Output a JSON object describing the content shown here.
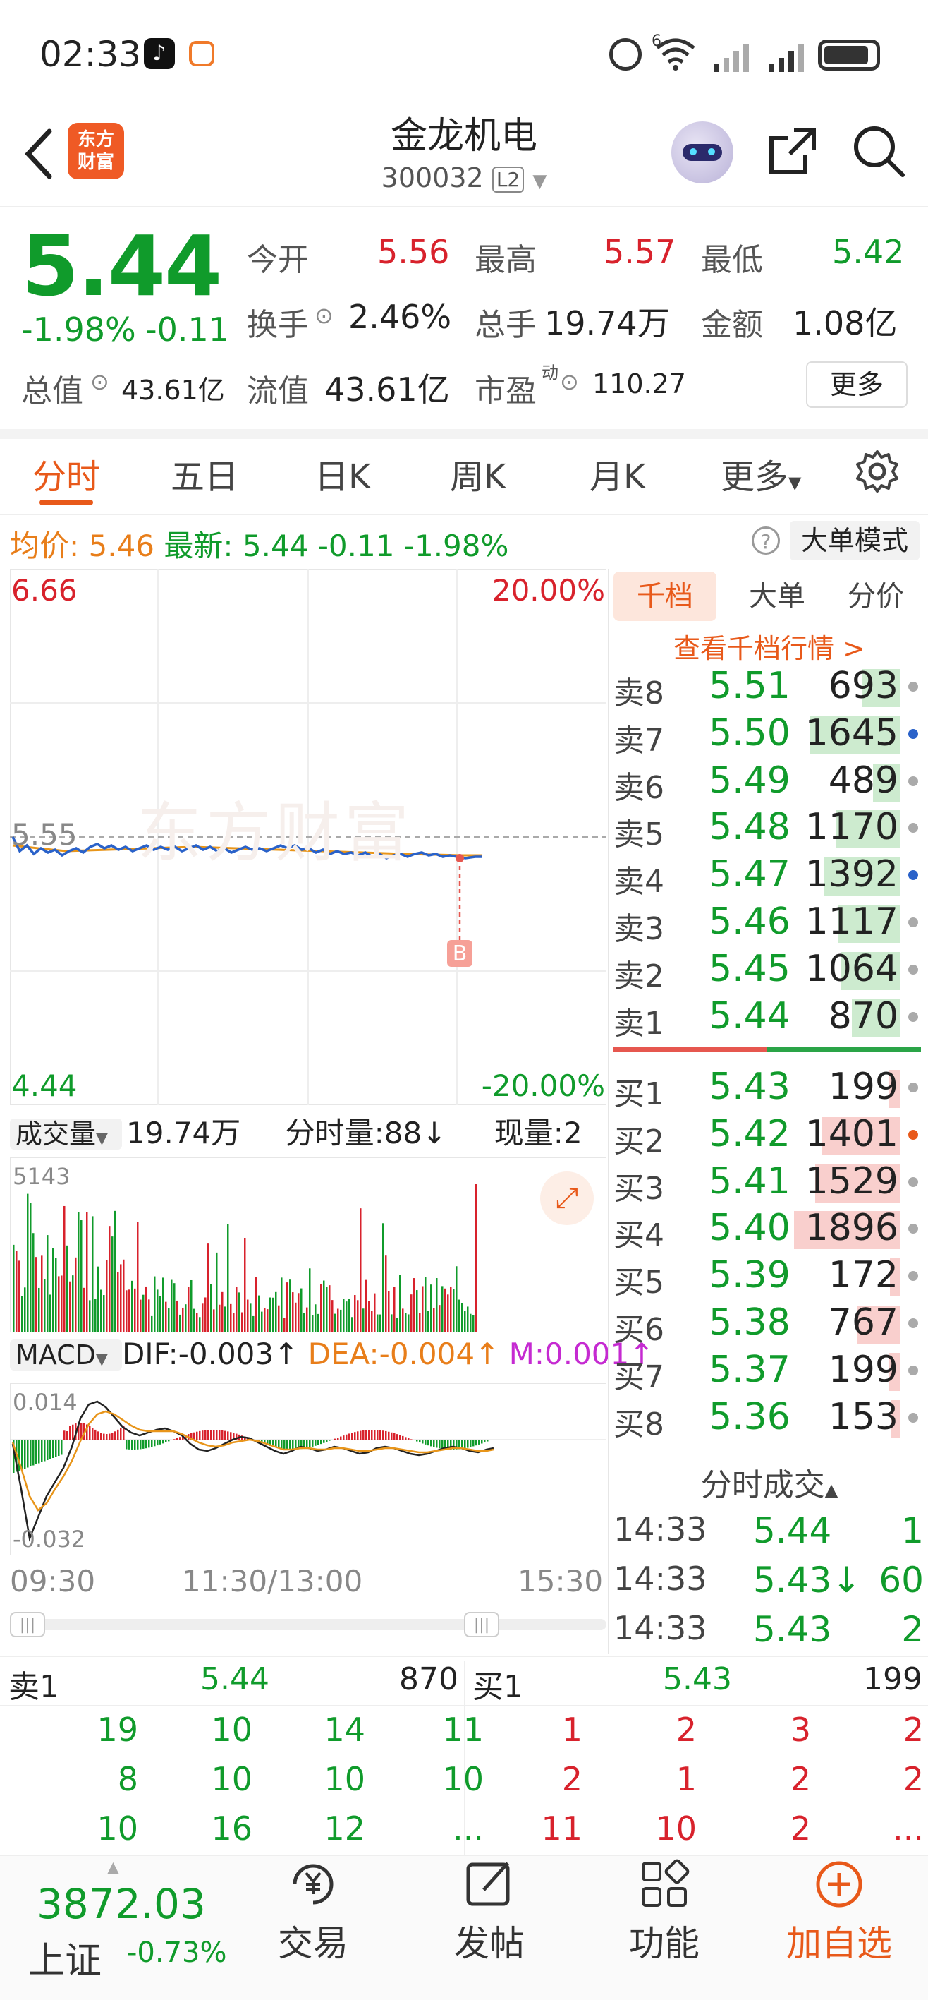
{
  "status_bar": {
    "time": "02:33",
    "network": "6"
  },
  "header": {
    "logo_text_1": "东方",
    "logo_text_2": "财富",
    "stock_name": "金龙机电",
    "stock_code": "300032",
    "level_badge": "L2"
  },
  "quote": {
    "price": "5.44",
    "change_pct": "-1.98%",
    "change": "-0.11",
    "open_label": "今开",
    "open": "5.56",
    "high_label": "最高",
    "high": "5.57",
    "low_label": "最低",
    "low": "5.42",
    "turnover_label": "换手",
    "turnover": "2.46%",
    "volume_label": "总手",
    "volume": "19.74万",
    "amount_label": "金额",
    "amount": "1.08亿",
    "mktcap_label": "总值",
    "mktcap": "43.61亿",
    "float_label": "流值",
    "float": "43.61亿",
    "pe_label": "市盈",
    "pe_sup": "动",
    "pe": "110.27",
    "more_button": "更多"
  },
  "tabs": [
    {
      "label": "分时"
    },
    {
      "label": "五日"
    },
    {
      "label": "日K"
    },
    {
      "label": "周K"
    },
    {
      "label": "月K"
    },
    {
      "label": "更多"
    }
  ],
  "infobar": {
    "avg_label": "均价:",
    "avg": "5.46",
    "latest_label": "最新:",
    "latest": "5.44",
    "chg": "-0.11",
    "chg_pct": "-1.98%",
    "help": "?",
    "big_order_button": "大单模式"
  },
  "chart": {
    "top_price": "6.66",
    "top_pct": "20.00%",
    "mid_price": "5.55",
    "bottom_price": "4.44",
    "bottom_pct": "-20.00%",
    "watermark": "东方财富",
    "marker": "B",
    "vol_selector": "成交量",
    "vol_total": "19.74万",
    "vol_tick_label": "分时量:88↓",
    "vol_now_label": "现量:2",
    "vol_max": "5143",
    "macd_selector": "MACD",
    "dif": "DIF:-0.003↑",
    "dea": "DEA:-0.004↑",
    "m": "M:0.001↑",
    "macd_top": "0.014",
    "macd_bottom": "-0.032",
    "time_start": "09:30",
    "time_mid": "11:30/13:00",
    "time_end": "15:30"
  },
  "orderbook": {
    "tabs": [
      "千档",
      "大单",
      "分价"
    ],
    "link": "查看千档行情 >",
    "sell": [
      {
        "label": "卖8",
        "price": "5.51",
        "vol": "693",
        "bar": 0.35
      },
      {
        "label": "卖7",
        "price": "5.50",
        "vol": "1645",
        "bar": 0.85
      },
      {
        "label": "卖6",
        "price": "5.49",
        "vol": "489",
        "bar": 0.25
      },
      {
        "label": "卖5",
        "price": "5.48",
        "vol": "1170",
        "bar": 0.6
      },
      {
        "label": "卖4",
        "price": "5.47",
        "vol": "1392",
        "bar": 0.72
      },
      {
        "label": "卖3",
        "price": "5.46",
        "vol": "1117",
        "bar": 0.58
      },
      {
        "label": "卖2",
        "price": "5.45",
        "vol": "1064",
        "bar": 0.55
      },
      {
        "label": "卖1",
        "price": "5.44",
        "vol": "870",
        "bar": 0.45
      }
    ],
    "buy": [
      {
        "label": "买1",
        "price": "5.43",
        "vol": "199",
        "bar": 0.1
      },
      {
        "label": "买2",
        "price": "5.42",
        "vol": "1401",
        "bar": 0.74
      },
      {
        "label": "买3",
        "price": "5.41",
        "vol": "1529",
        "bar": 0.8
      },
      {
        "label": "买4",
        "price": "5.40",
        "vol": "1896",
        "bar": 1.0
      },
      {
        "label": "买5",
        "price": "5.39",
        "vol": "172",
        "bar": 0.09
      },
      {
        "label": "买6",
        "price": "5.38",
        "vol": "767",
        "bar": 0.4
      },
      {
        "label": "买7",
        "price": "5.37",
        "vol": "199",
        "bar": 0.1
      },
      {
        "label": "买8",
        "price": "5.36",
        "vol": "153",
        "bar": 0.08
      }
    ],
    "trades_title": "分时成交",
    "trades": [
      {
        "time": "14:33",
        "price": "5.44",
        "vol": "1"
      },
      {
        "time": "14:33",
        "price": "5.43↓",
        "vol": "60"
      },
      {
        "time": "14:33",
        "price": "5.43",
        "vol": "2"
      }
    ]
  },
  "queue": {
    "sell_label": "卖1",
    "sell_price": "5.44",
    "sell_vol": "870",
    "buy_label": "买1",
    "buy_price": "5.43",
    "buy_vol": "199",
    "sell_rows": [
      [
        "19",
        "10",
        "14",
        "11"
      ],
      [
        "8",
        "10",
        "10",
        "10"
      ],
      [
        "10",
        "16",
        "12",
        "..."
      ]
    ],
    "buy_rows": [
      [
        "1",
        "2",
        "3",
        "2"
      ],
      [
        "2",
        "1",
        "2",
        "2"
      ],
      [
        "11",
        "10",
        "2",
        "..."
      ]
    ]
  },
  "bottom": {
    "index_value": "3872.03",
    "index_name": "上证",
    "index_chg": "-0.73%",
    "nav": [
      {
        "label": "交易"
      },
      {
        "label": "发帖"
      },
      {
        "label": "功能"
      },
      {
        "label": "加自选"
      }
    ]
  }
}
